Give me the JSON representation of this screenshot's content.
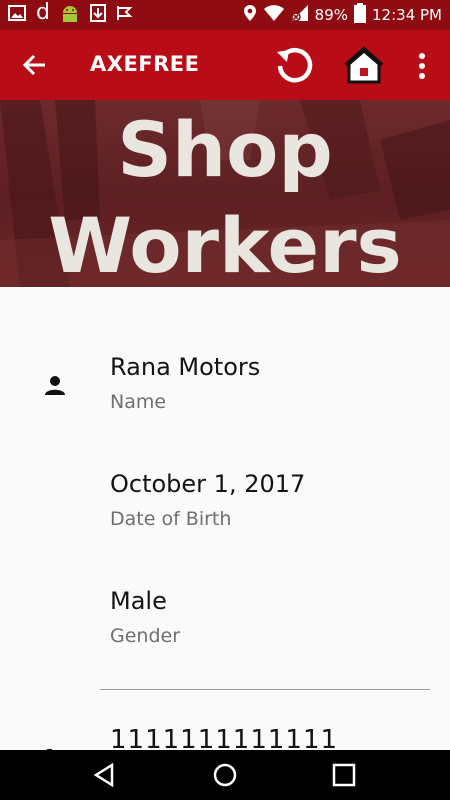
{
  "status_bar": {
    "battery": "89%",
    "time": "12:34 PM",
    "icons": [
      "image-icon",
      "d-app-icon",
      "android-icon",
      "download-icon",
      "check-flag-icon",
      "location-icon",
      "wifi-icon",
      "signal-icon",
      "battery-icon"
    ]
  },
  "app_bar": {
    "title": "AXEFREE",
    "icons": [
      "back-arrow-icon",
      "refresh-icon",
      "home-icon",
      "more-vert-icon"
    ]
  },
  "hero": {
    "line1": "Shop",
    "line2": "Workers"
  },
  "profile": {
    "fields": [
      {
        "value": "Rana Motors",
        "label": "Name"
      },
      {
        "value": "October 1, 2017",
        "label": "Date of Birth"
      },
      {
        "value": "Male",
        "label": "Gender"
      }
    ],
    "partial_value": "1111111111111"
  },
  "nav": {
    "icons": [
      "back-triangle-icon",
      "home-circle-icon",
      "recents-square-icon"
    ]
  },
  "colors": {
    "status_bar": "#8e0b12",
    "app_bar": "#b80d17",
    "hero": "#6a2426"
  }
}
